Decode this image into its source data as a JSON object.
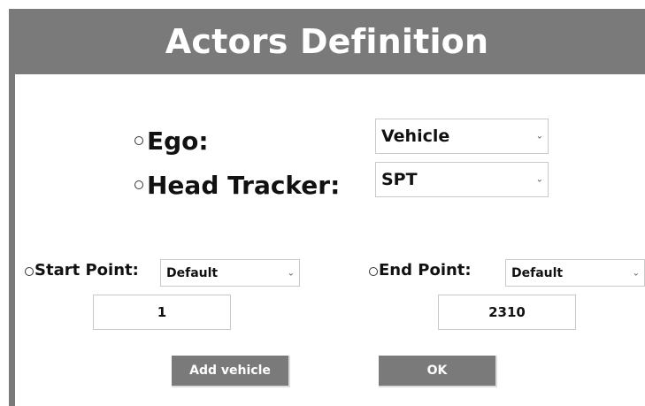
{
  "title": "Actors Definition",
  "ego": {
    "label": "Ego:",
    "selected": "Vehicle"
  },
  "head_tracker": {
    "label": "Head Tracker:",
    "selected": "SPT"
  },
  "start_point": {
    "label": "Start Point:",
    "selected": "Default",
    "value": "1"
  },
  "end_point": {
    "label": "End Point:",
    "selected": "Default",
    "value": "2310"
  },
  "buttons": {
    "add_vehicle": "Add vehicle",
    "ok": "OK"
  },
  "icons": {
    "dropdown": "chevron-down-icon",
    "radio": "radio-button-icon"
  },
  "colors": {
    "accent_gray": "#7a7a7a",
    "background": "#ffffff",
    "text": "#111111"
  }
}
